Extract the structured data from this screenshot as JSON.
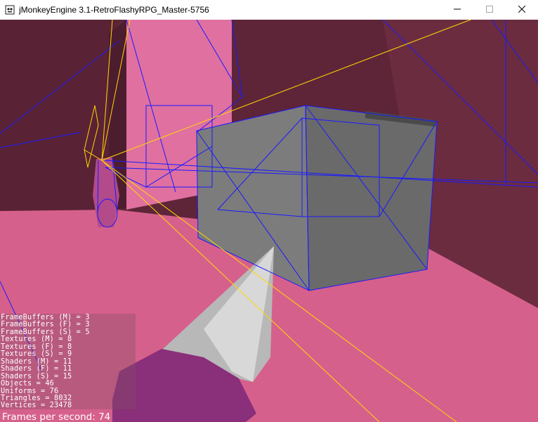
{
  "window": {
    "title": "jMonkeyEngine 3.1-RetroFlashyRPG_Master-5756",
    "icons": {
      "app": "jmonkey-app-icon",
      "minimize": "minimize-icon",
      "maximize": "maximize-icon",
      "close": "close-icon"
    }
  },
  "stats": {
    "lines": [
      "FrameBuffers (M) = 3",
      "FrameBuffers (F) = 3",
      "FrameBuffers (S) = 5",
      "Textures (M) = 8",
      "Textures (F) = 8",
      "Textures (S) = 9",
      "Shaders (M) = 11",
      "Shaders (F) = 11",
      "Shaders (S) = 15",
      "Objects = 46",
      "Uniforms = 76",
      "Triangles = 8032",
      "Vertices = 23478"
    ],
    "fps_label": "Frames per second: 74"
  },
  "colors": {
    "floor": "#d6608c",
    "wall_dark": "#5e2538",
    "wireframe_blue": "#1a1aff",
    "wireframe_yellow": "#ffd800",
    "crate": "#7a7a7a"
  }
}
